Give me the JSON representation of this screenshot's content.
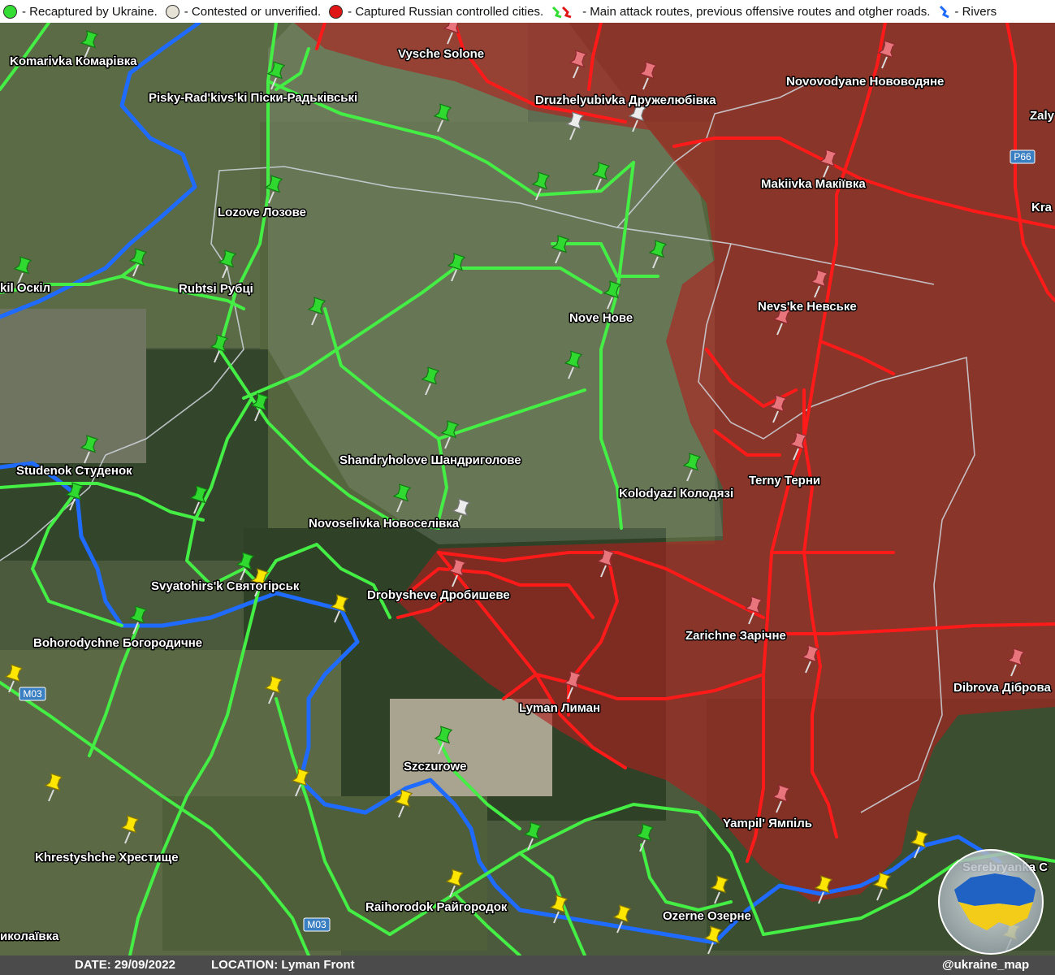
{
  "legend": {
    "ukraine": "- Recaptured by Ukraine.",
    "contested": "- Contested or unverified.",
    "russia": "- Captured Russian controlled cities.",
    "routes": "- Main attack routes, previous offensive routes and otgher roads.",
    "rivers": "- Rivers"
  },
  "footer": {
    "date": "DATE: 29/09/2022",
    "location": "LOCATION: Lyman Front",
    "handle": "@ukraine_map"
  },
  "colors": {
    "ukraine": "#33dd33",
    "contested": "#e6e2d6",
    "russia": "#e01515",
    "yellow": "#ffe600",
    "river": "#1f6bff",
    "road": "#44ee44"
  },
  "road_signs": [
    "P66",
    "M03",
    "M03"
  ],
  "places": [
    {
      "label": "Komarivka Комарівка"
    },
    {
      "label": "Pisky-Rad'kivs'ki Піски-Радьківські"
    },
    {
      "label": "Lozove Лозове"
    },
    {
      "label": "Rubtsi Рубці"
    },
    {
      "label": "kil Оскіл"
    },
    {
      "label": "Studenok Студенок"
    },
    {
      "label": "Shandryholove Шандриголове"
    },
    {
      "label": "Novoselivka Новоселівка"
    },
    {
      "label": "Svyatohirs'k Святогірськ"
    },
    {
      "label": "Bohorodychne Богородичне"
    },
    {
      "label": "Drobysheve Дробишеве"
    },
    {
      "label": "Lyman Лиман"
    },
    {
      "label": "Szczurowe"
    },
    {
      "label": "Khrestyshche Хрестище"
    },
    {
      "label": "Raihorodok Райгородок"
    },
    {
      "label": "Ozerne Озерне"
    },
    {
      "label": "Vysche Solone"
    },
    {
      "label": "Druzhelyubivka Дружелюбівка"
    },
    {
      "label": "Novovodyane Нововодяне"
    },
    {
      "label": "Makiivka Макіївка"
    },
    {
      "label": "Nove Нове"
    },
    {
      "label": "Nevs'ke Невське"
    },
    {
      "label": "Terny Терни"
    },
    {
      "label": "Kolodyazi Колодязі"
    },
    {
      "label": "Zarichne Зарічне"
    },
    {
      "label": "Dibrova Діброва"
    },
    {
      "label": "Yampil' Ямпіль"
    },
    {
      "label": "Serebryanka С"
    },
    {
      "label": "Zaly"
    },
    {
      "label": "Kra"
    },
    {
      "label": "иколаївка"
    }
  ]
}
